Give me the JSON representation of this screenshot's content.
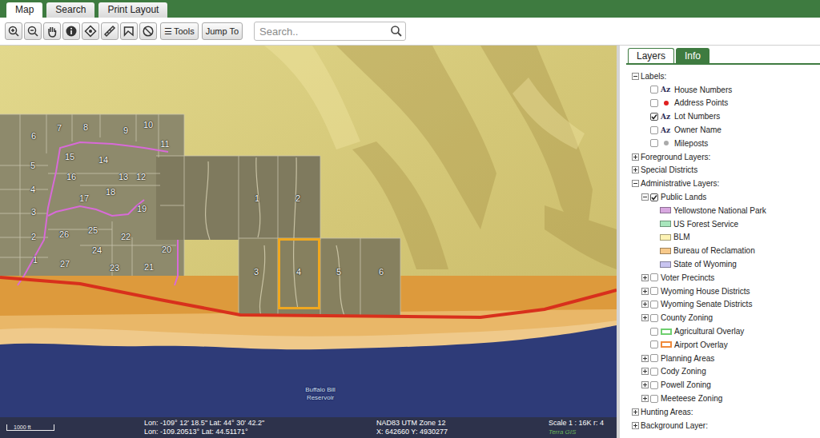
{
  "tabs": [
    {
      "label": "Map",
      "selected": true
    },
    {
      "label": "Search",
      "selected": false
    },
    {
      "label": "Print Layout",
      "selected": false
    }
  ],
  "toolbar": {
    "tools_button": {
      "icon": "☰",
      "label": "Tools"
    },
    "jump_button": {
      "label": "Jump To"
    },
    "search": {
      "placeholder": "Search.."
    }
  },
  "map": {
    "lots": [
      {
        "number": "6",
        "selected": false
      },
      {
        "number": "7",
        "selected": false
      },
      {
        "number": "8",
        "selected": false
      },
      {
        "number": "9",
        "selected": false
      },
      {
        "number": "10",
        "selected": false
      },
      {
        "number": "11",
        "selected": false
      },
      {
        "number": "15",
        "selected": false
      },
      {
        "number": "14",
        "selected": false
      },
      {
        "number": "5",
        "selected": false
      },
      {
        "number": "16",
        "selected": false
      },
      {
        "number": "13",
        "selected": false
      },
      {
        "number": "12",
        "selected": false
      },
      {
        "number": "4",
        "selected": false
      },
      {
        "number": "17",
        "selected": false
      },
      {
        "number": "18",
        "selected": false
      },
      {
        "number": "1",
        "selected": false
      },
      {
        "number": "2",
        "selected": false
      },
      {
        "number": "3",
        "selected": false
      },
      {
        "number": "19",
        "selected": false
      },
      {
        "number": "26",
        "selected": false
      },
      {
        "number": "25",
        "selected": false
      },
      {
        "number": "22",
        "selected": false
      },
      {
        "number": "2",
        "selected": false
      },
      {
        "number": "20",
        "selected": false
      },
      {
        "number": "24",
        "selected": false
      },
      {
        "number": "1",
        "selected": false
      },
      {
        "number": "27",
        "selected": false
      },
      {
        "number": "23",
        "selected": false
      },
      {
        "number": "21",
        "selected": false
      },
      {
        "number": "3",
        "selected": false
      },
      {
        "number": "4",
        "selected": true
      },
      {
        "number": "5",
        "selected": false
      },
      {
        "number": "6",
        "selected": false
      }
    ],
    "water_label": "Buffalo Bill Reservoir",
    "status": {
      "scale_bar": "1000 ft",
      "lonlat_dms": "Lon: -109° 12' 18.5\" Lat: 44° 30' 42.2\"",
      "lonlat_dec": "Lon: -109.20513° Lat: 44.51171°",
      "projection": "NAD83 UTM Zone 12",
      "xy": "X: 642660 Y: 4930277",
      "scale": "Scale 1 : 16K r: 4",
      "brand": "Terra GIS"
    }
  },
  "panel": {
    "tabs": [
      {
        "label": "Layers",
        "selected": true
      },
      {
        "label": "Info",
        "selected": false
      }
    ],
    "tree": [
      {
        "kind": "group",
        "label": "Labels:",
        "expanded": true,
        "children": [
          {
            "kind": "text-label",
            "icon": "Az",
            "label": "House Numbers",
            "checked": false
          },
          {
            "kind": "point-label",
            "color": "#e02020",
            "label": "Address Points",
            "checked": false
          },
          {
            "kind": "text-label",
            "icon": "Az",
            "label": "Lot Numbers",
            "checked": true
          },
          {
            "kind": "text-label",
            "icon": "Az",
            "label": "Owner Name",
            "checked": false
          },
          {
            "kind": "point-label",
            "color": "#aaaaaa",
            "label": "Mileposts",
            "checked": false
          }
        ]
      },
      {
        "kind": "group",
        "label": "Foreground Layers:",
        "expanded": false
      },
      {
        "kind": "group",
        "label": "Special Districts",
        "expanded": false
      },
      {
        "kind": "group",
        "label": "Administrative Layers:",
        "expanded": true,
        "children": [
          {
            "kind": "group",
            "label": "Public Lands",
            "expanded": true,
            "checked": true,
            "children": [
              {
                "kind": "legend",
                "label": "Yellowstone National Park",
                "color": "#d8a8e0"
              },
              {
                "kind": "legend",
                "label": "US Forest Service",
                "color": "#a8e6bc"
              },
              {
                "kind": "legend",
                "label": "BLM",
                "color": "#fdf3b4"
              },
              {
                "kind": "legend",
                "label": "Bureau of Reclamation",
                "color": "#f7c98a"
              },
              {
                "kind": "legend",
                "label": "State of Wyoming",
                "color": "#c8c4f0"
              }
            ]
          },
          {
            "kind": "group",
            "label": "Voter Precincts",
            "expanded": false,
            "checked": false
          },
          {
            "kind": "group",
            "label": "Wyoming House Districts",
            "expanded": false,
            "checked": false
          },
          {
            "kind": "group",
            "label": "Wyoming Senate Districts",
            "expanded": false,
            "checked": false
          },
          {
            "kind": "group",
            "label": "County Zoning",
            "expanded": false,
            "checked": false
          },
          {
            "kind": "overlay",
            "label": "Agricultural Overlay",
            "checked": false,
            "color": "#6fcf6f"
          },
          {
            "kind": "overlay",
            "label": "Airport Overlay",
            "checked": false,
            "color": "#f08a3a"
          },
          {
            "kind": "group",
            "label": "Planning Areas",
            "expanded": false,
            "checked": false
          },
          {
            "kind": "group",
            "label": "Cody Zoning",
            "expanded": false,
            "checked": false
          },
          {
            "kind": "group",
            "label": "Powell Zoning",
            "expanded": false,
            "checked": false
          },
          {
            "kind": "group",
            "label": "Meeteese Zoning",
            "expanded": false,
            "checked": false
          }
        ]
      },
      {
        "kind": "group",
        "label": "Hunting Areas:",
        "expanded": false
      },
      {
        "kind": "group",
        "label": "Background Layer:",
        "expanded": false
      }
    ]
  }
}
